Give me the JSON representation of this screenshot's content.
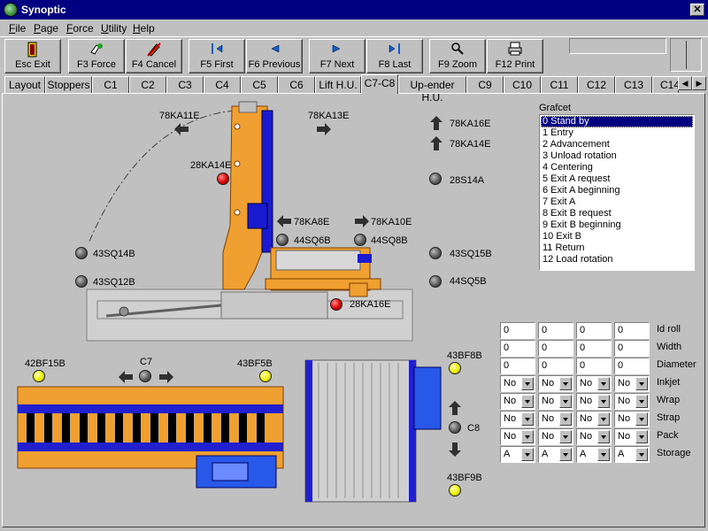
{
  "window": {
    "title": "Synoptic"
  },
  "menu": [
    "File",
    "Page",
    "Force",
    "Utility",
    "Help"
  ],
  "toolbar": {
    "buttons": [
      {
        "id": "exit",
        "label": "Esc Exit"
      },
      {
        "id": "force",
        "label": "F3 Force"
      },
      {
        "id": "cancel",
        "label": "F4 Cancel"
      },
      {
        "id": "first",
        "label": "F5 First"
      },
      {
        "id": "previous",
        "label": "F6 Previous"
      },
      {
        "id": "next",
        "label": "F7 Next"
      },
      {
        "id": "last",
        "label": "F8 Last"
      },
      {
        "id": "zoom",
        "label": "F9 Zoom"
      },
      {
        "id": "print",
        "label": "F12 Print"
      }
    ]
  },
  "tabs": [
    "Layout",
    "Stoppers",
    "C1",
    "C2",
    "C3",
    "C4",
    "C5",
    "C6",
    "Lift H.U.",
    "C7-C8",
    "Up-ender H.U.",
    "C9",
    "C10",
    "C11",
    "C12",
    "C13",
    "C14"
  ],
  "active_tab": "C7-C8",
  "synoptic": {
    "labels": {
      "ka11e": "78KA11E",
      "ka13e": "78KA13E",
      "ka16e_top": "78KA16E",
      "ka14e_top": "78KA14E",
      "ka14e_mid": "28KA14E",
      "s14a": "28S14A",
      "ka8e": "78KA8E",
      "ka10e": "78KA10E",
      "sq6b": "44SQ6B",
      "sq8b": "44SQ8B",
      "sq14b": "43SQ14B",
      "sq15b": "43SQ15B",
      "sq12b": "43SQ12B",
      "sq5b": "44SQ5B",
      "ka16e_low": "28KA16E",
      "bf15b": "42BF15B",
      "c7": "C7",
      "bf5b": "43BF5B",
      "bf8b": "43BF8B",
      "c8": "C8",
      "bf9b": "43BF9B"
    }
  },
  "grafcet": {
    "title": "Grafcet",
    "items": [
      "0 Stand by",
      "1 Entry",
      "2 Advancement",
      "3 Unload rotation",
      "4 Centering",
      "5 Exit A request",
      "6 Exit A beginning",
      "7 Exit A",
      "8 Exit B request",
      "9 Exit B beginning",
      "10 Exit B",
      "11 Return",
      "12 Load rotation"
    ],
    "selected_index": 0
  },
  "params": {
    "rows": [
      {
        "label": "Id roll",
        "type": "input",
        "values": [
          "0",
          "0",
          "0",
          "0"
        ]
      },
      {
        "label": "Width",
        "type": "input",
        "values": [
          "0",
          "0",
          "0",
          "0"
        ]
      },
      {
        "label": "Diameter",
        "type": "input",
        "values": [
          "0",
          "0",
          "0",
          "0"
        ]
      },
      {
        "label": "Inkjet",
        "type": "select",
        "values": [
          "No",
          "No",
          "No",
          "No"
        ]
      },
      {
        "label": "Wrap",
        "type": "select",
        "values": [
          "No",
          "No",
          "No",
          "No"
        ]
      },
      {
        "label": "Strap",
        "type": "select",
        "values": [
          "No",
          "No",
          "No",
          "No"
        ]
      },
      {
        "label": "Pack",
        "type": "select",
        "values": [
          "No",
          "No",
          "No",
          "No"
        ]
      },
      {
        "label": "Storage",
        "type": "select",
        "values": [
          "A",
          "A",
          "A",
          "A"
        ]
      }
    ]
  },
  "colors": {
    "machine_orange": "#f0a030",
    "machine_blue": "#1a1ad0",
    "machine_base": "#d8d8d8",
    "selection": "#000080"
  }
}
